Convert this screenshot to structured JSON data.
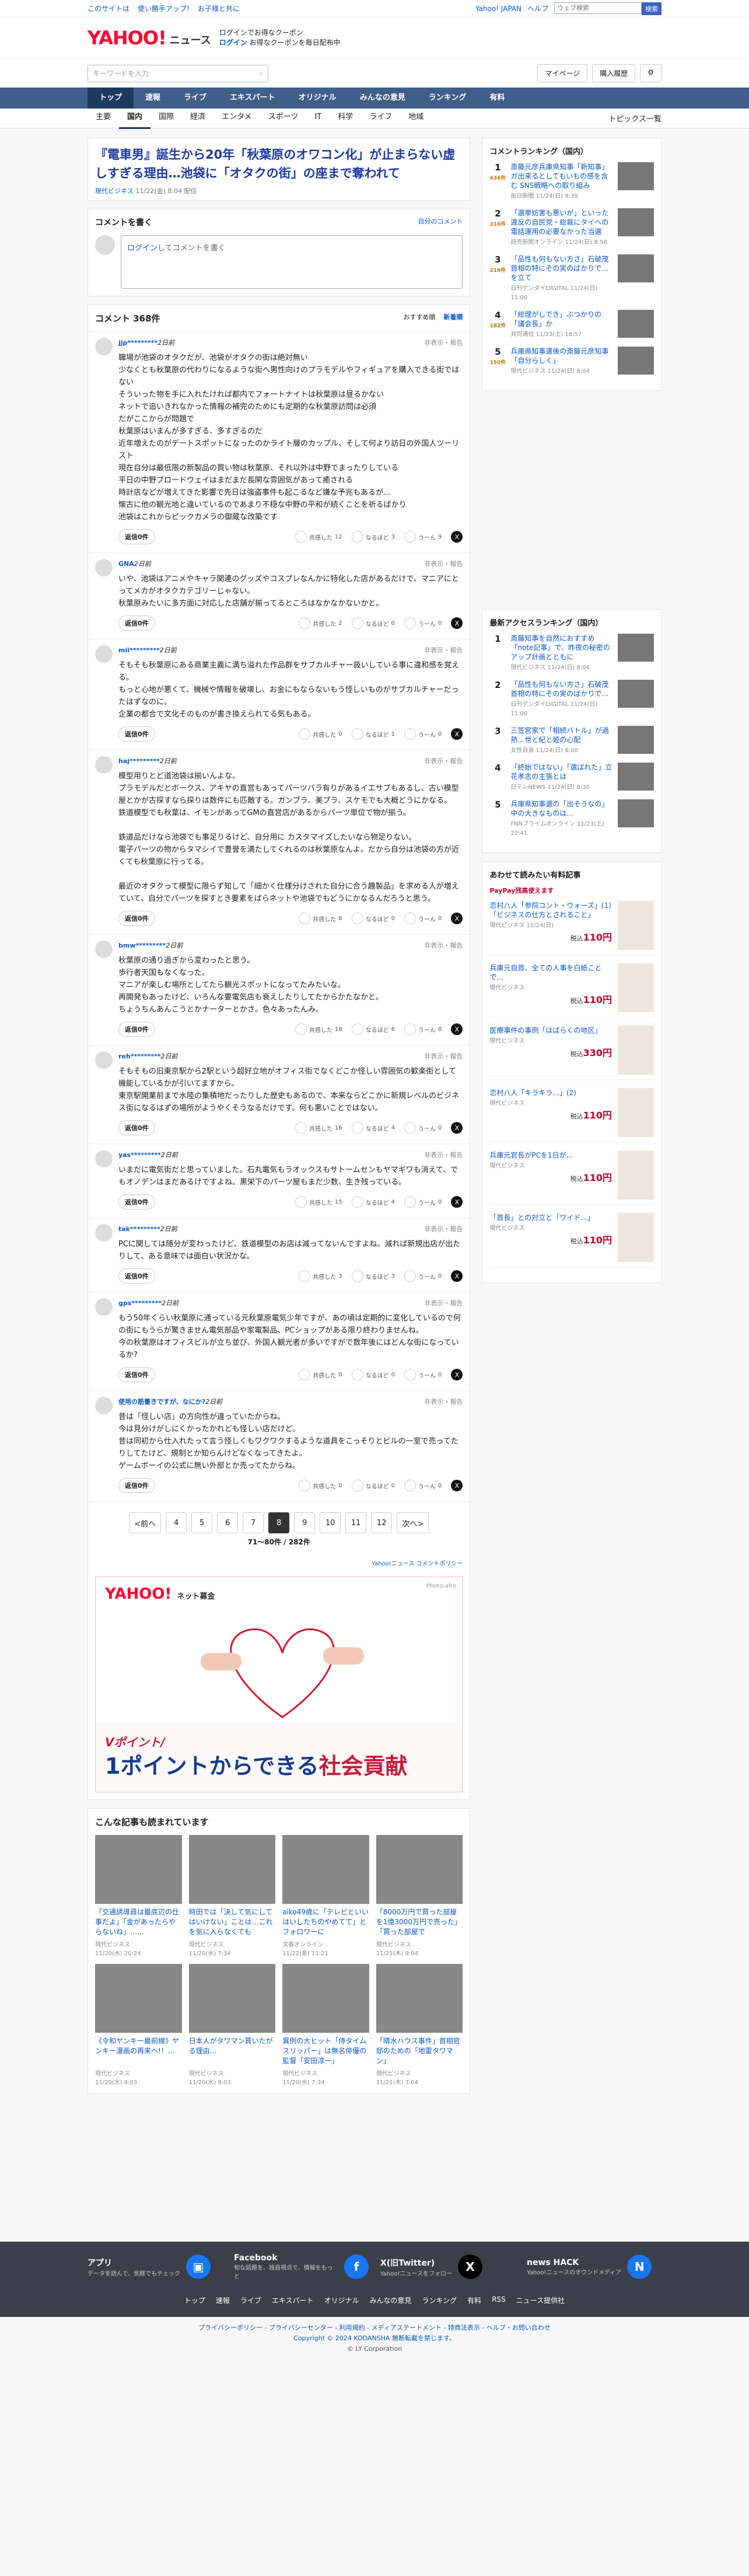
{
  "topbar": {
    "left": [
      "このサイトは",
      "使い勝手アップ!",
      "お子様と共に"
    ],
    "right": [
      "Yahoo! JAPAN",
      "ヘルプ"
    ],
    "search_ph": "ウェブ検索",
    "search_btn": "検索"
  },
  "header": {
    "logo": "YAHOO!",
    "logo_sub": "JAPAN",
    "service": "ニュース",
    "promo_line1": "ログインでお得なクーポン",
    "promo_line2": "ログイン",
    "promo_line3": "お得なクーポンを毎日配布中"
  },
  "search": {
    "placeholder": "キーワードを入力",
    "mypage": "マイページ",
    "buy": "購入履歴"
  },
  "gnav": [
    "トップ",
    "速報",
    "ライブ",
    "エキスパート",
    "オリジナル",
    "みんなの意見",
    "ランキング",
    "有料"
  ],
  "subnav": [
    "主要",
    "国内",
    "国際",
    "経済",
    "エンタメ",
    "スポーツ",
    "IT",
    "科学",
    "ライフ",
    "地域"
  ],
  "subnav_topic": "トピックス一覧",
  "article": {
    "title": "『電車男』誕生から20年「秋葉原のオワコン化」が止まらない虚しすぎる理由…池袋に「オタクの街」の座まで奪われて",
    "source": "現代ビジネス",
    "date": "11/22(金) 8:04 配信"
  },
  "comment_write": {
    "title": "コメントを書く",
    "link": "自分のコメント",
    "login": "ログイン",
    "text": "してコメントを書く"
  },
  "comments": {
    "title": "コメント 368件",
    "sort1": "おすすめ順",
    "sort2": "新着順",
    "reply": "返信0件",
    "support": "共感した",
    "think": "なるほど",
    "ask": "うーん",
    "report": "非表示・報告",
    "items": [
      {
        "user": "jjp*********",
        "time": "2日前",
        "text": "職場が池袋のオタクだが、池袋がオタクの街は絶対無い\n少なくとも秋葉原の代わりになるような街へ男性向けのプラモデルやフィギュアを購入できる街ではない\nそういった物を手に入れたければ都内でフォートナイトは秋葉原は昼るかない\nネットで追いきれなかった情報の補完のためにも定期的な秋葉原訪問は必須\nだがここからが問題で\n秋葉原はいまんが多すぎる、多すぎるのだ\n近年増えたのがデートスポットになったのかライト層のカップル、そして何より訪日の外国人ツーリスト\n現在自分は最低限の新製品の買い物は秋葉原、それ以外は中野でまったりしている\n平日の中野ブロードウェイはまだまだ長閑な雰囲気があって癒される\n時計店などが増えてきた影響で先日は強盗事件も起こるなど嫌な予兆もあるが…\n懐古に他の観光地と違いているのであまり不穏な中野の平和が続くことを祈るばかり\n池袋はこれからピックカメラの御蔵な改築です",
        "a": 12,
        "b": 3,
        "c": 9
      },
      {
        "user": "GNA",
        "time": "2日前",
        "text": "いや、池袋はアニメやキャラ関連のグッズやコスプレなんかに特化した店があるだけで、マニアにとってメカがオタクカテゴリーじゃない。\n秋葉原みたいに多方面に対応した店舗が揃ってるところはなかなかないかと。",
        "a": 2,
        "b": 0,
        "c": 0
      },
      {
        "user": "mii*********",
        "time": "2日前",
        "text": "そもそも秋葉原にある商業主義に満ち溢れた作品群をサブカルチャー扱いしている事に違和感を覚える。\nもっと心地が悪くて、機械や情報を破壊し、お金にもならないもう怪しいものがサブカルチャーだったはずなのに。\n企業の都合で文化そのものが書き換えられてる気もある。",
        "a": 0,
        "b": 1,
        "c": 0
      },
      {
        "user": "haj*********",
        "time": "2日前",
        "text": "模型用りとど道池袋は揃いんよな。\nプラモデルだとボークス、アキヤの直営もあってパーツバラ有りがあるイエサブもあるし、古い模型屋とかが古探すなら探りは数件にも匹敵する。ガンプラ、美プラ、スケモでも大概どうにかなる。\n鉄道模型でも秋葉は、イモンがあってGMの直営店があるからパーツ単位で物が揃う。\n\n鉄道品だけなら池袋でも事足りるけど、自分用に カスタマイズしたいなら物足りない。\n電子パーツの物からタマシイで豊誉を満たしてくれるのは秋葉原なんよ。だから自分は池袋の方が近くても秋葉原に行ってる。\n\n最近のオタクって模型に限らず知して「細かく仕様分けされた自分に合う趣製品」を求める人が増えていて、自分でパーツを探すとき要素をばらネットや池袋でもどうにかなるんだろうと思う。",
        "a": 6,
        "b": 0,
        "c": 0
      },
      {
        "user": "bmw*********",
        "time": "2日前",
        "text": "秋葉原の通り過ぎから変わったと思う。\n歩行者天国もなくなった。\nマニアが楽しむ場所としてたら観光スポットになってたみたいな。\n再開発もあったけど、いろんな要電気店も衰えしたりしてたからかたなかと。\nちょうちんあんこうとかナーターとかさ。色々あったんみ。",
        "a": 18,
        "b": 6,
        "c": 0
      },
      {
        "user": "reh*********",
        "time": "2日前",
        "text": "そもそもの旧東京駅から2駅という超好立地がオフィス街でなくどこか怪しい雰囲気の歓楽街として機能しているかが引いてますから。\n東京駅開業前まで水陸の集積地だったりした歴史もあるので、本来ならどこかに新規レベルのビジネス街になるはずの場所がようやくそうなるだけです。何も悪いことではない。",
        "a": 16,
        "b": 4,
        "c": 0
      },
      {
        "user": "yas*********",
        "time": "2日前",
        "text": "いまだに電気街だと思っていました。石丸電気もラオックスもサトームセンもヤマギワも消えて、でもオノデンはまだあるけですよね。黒栄下のパーツ屋もまだ少数、生き残っている。",
        "a": 15,
        "b": 4,
        "c": 0
      },
      {
        "user": "tak*********",
        "time": "2日前",
        "text": "PCに関しては随分が変わったけど、鉄道模型のお店は減ってないんですよね。減れば新規出店が出たりして、ある意味では面白い状況かな。",
        "a": 3,
        "b": 3,
        "c": 0
      },
      {
        "user": "gps*********",
        "time": "2日前",
        "text": "もう50年くらい秋葉原に通っている元秋葉原電気少年ですが、あの頃は定期的に変化しているので何の街にもうらが驚きません電気部品や家電製品、PCショップがある限り終わりませんね。\n今の秋葉原はオフィスビルが立ち並び、外国人観光者が多いですがで数年後にはどんな街になっているか?",
        "a": 0,
        "b": 0,
        "c": 0
      },
      {
        "user": "使用の筋書きですが、なにか?",
        "time": "2日前",
        "text": "昔は「怪しい店」の方向性が違っていたからね。\n今は見分けがしにくかったかれども怪しい店だけど。\n昔は同初から仕入れたって言う怪しくもワクワクするような道具をこっそりとビルの一室で売ってたりしてたけど、規制とか知らんけどなくなってきたよ。\nゲームボーイの公式に無い外部とか売ってたからね。",
        "a": 0,
        "b": 0,
        "c": 0
      }
    ]
  },
  "pager": {
    "prev": "<前へ",
    "next": "次へ>",
    "pages": [
      "4",
      "5",
      "6",
      "7",
      "8",
      "9",
      "10",
      "11",
      "12"
    ],
    "current": "8",
    "info": "71〜80件 / 282件"
  },
  "policy": "Yahoo!ニュース コメントポリシー",
  "ad": {
    "brand": "YAHOO!",
    "brand_sub": "ネット募金",
    "photo": "Photo:afro",
    "sub": "Vポイント/",
    "main": "1ポイントからできる",
    "main2": "社会貢献"
  },
  "related": {
    "title": "こんな記事も読まれています",
    "items": [
      {
        "t": "「交通誘導員は最底辺の仕事だよ」「金があったらやらないね」……",
        "s": "現代ビジネス",
        "d": "11/20(水) 20:24"
      },
      {
        "t": "時田では「決して気にしてはいけない」ことは…これを気に入らなくても",
        "s": "現代ビジネス",
        "d": "11/20(水) 7:34"
      },
      {
        "t": "aiko49歳に「テレビといいはいしたちのやめてて」とフォロワーに",
        "s": "文春オンライン",
        "d": "11/22(金) 11:21"
      },
      {
        "t": "「8000万円で買った部屋を1億3000万円で売った」「買った部屋で",
        "s": "現代ビジネス",
        "d": "11/21(木) 9:04"
      },
      {
        "t": "《令和ヤンキー最前線》ヤンキー漫画の再来へ!！…",
        "s": "現代ビジネス",
        "d": "11/20(水) 8:03"
      },
      {
        "t": "日本人がタワマン買いたがる理由…",
        "s": "現代ビジネス",
        "d": "11/20(水) 8:03"
      },
      {
        "t": "異例の大ヒット「侍タイムスリッパー」は無名俳優の監督「安田淳一」",
        "s": "現代ビジネス",
        "d": "11/20(水) 7:34"
      },
      {
        "t": "「晴水ハウス事件」首相官邸のための「地雷タワマン」",
        "s": "現代ビジネス",
        "d": "11/21(木) 7:04"
      }
    ]
  },
  "side_ranking": {
    "title": "コメントランキング（国内）",
    "items": [
      {
        "n": "1",
        "c": "436件",
        "t": "斎藤元彦兵庫県知事「新知事」ガ出来るとしてもいもの感を含む SNS戦略への取り組み",
        "m": "毎日新聞 11/24(日) 9:39"
      },
      {
        "n": "2",
        "c": "316件",
        "t": "「選挙妨害も悪いが」といった違反の自民党・総裁にタイへの電話運用の必要なかった当選",
        "m": "読売新聞オンライン 11/24(日) 8:56"
      },
      {
        "n": "3",
        "c": "216件",
        "t": "「品性も何もない方さ」石破茂首相の特にその実のばかりで…を立て",
        "m": "日刊ゲンダイDIGITAL 11/24(日) 11:00"
      },
      {
        "n": "4",
        "c": "182件",
        "t": "「総理がしでき」ぶつかりの「議会長」か",
        "m": "共同通信 11/23(土) 18:57"
      },
      {
        "n": "5",
        "c": "150件",
        "t": "兵庫県知事選後の斎藤元彦知事「自分らしく」",
        "m": "現代ビジネス 11/24(日) 8:04"
      }
    ]
  },
  "side_access": {
    "title": "最新アクセスランキング（国内）",
    "items": [
      {
        "n": "1",
        "t": "斎藤知事を自然におすすめ「note記事」で、昨夜の秘密のアップ計画とともに",
        "m": "現代ビジネス 11/24(日) 8:04"
      },
      {
        "n": "2",
        "t": "「品性も何もない方さ」石破茂首相の特にその実のばかりで…",
        "m": "日刊ゲンダイDIGITAL 11/24(日) 11:00"
      },
      {
        "n": "3",
        "t": "三笠宮家で「相続バトル」が過熱…世と紀と姫の心配",
        "m": "女性自身 11/24(日) 6:00"
      },
      {
        "n": "4",
        "t": "「終始ではない」「選ばれた」立花孝志の主張とは",
        "m": "日テレNEWS 11/24(日) 8:30"
      },
      {
        "n": "5",
        "t": "兵庫県知事選の「出そうなの」中の大きなものは...",
        "m": "FNNプライムオンライン 11/23(土) 22:41"
      }
    ]
  },
  "books": {
    "title": "あわせて読みたい有料記事",
    "paypay": "PayPay残高使えます",
    "price_label": "税込",
    "items": [
      {
        "t": "恋村八人「参院コント・ウォーズ」(1)「ビジネスの仕方とされること」",
        "m": "現代ビジネス 11/24(日)",
        "p": "110円"
      },
      {
        "t": "兵庫元自首、全ての人事を白紙ことで...",
        "m": "現代ビジネス",
        "p": "110円"
      },
      {
        "t": "医療事件の事例「はばらくの地区」",
        "m": "現代ビジネス",
        "p": "330円"
      },
      {
        "t": "恋村八人「キラキラ...」(2)",
        "m": "現代ビジネス",
        "p": "110円"
      },
      {
        "t": "兵庫元官長がPCを1日が...",
        "m": "現代ビジネス",
        "p": "110円"
      },
      {
        "t": "「首長」との対立と「ワイド...」",
        "m": "現代ビジネス",
        "p": "110円"
      }
    ]
  },
  "footer": {
    "apps": [
      {
        "t": "アプリ",
        "d": "データを読んで、気軽でもチェック"
      },
      {
        "t": "Facebook",
        "d": "旬な話題を、独自視点で、情報をもっと"
      },
      {
        "t": "X(旧Twitter)",
        "d": "Yahoo!ニュースをフォロー"
      },
      {
        "t": "news HACK",
        "d": "Yahoo!ニュースのオウンドメディア"
      }
    ],
    "nav": [
      "トップ",
      "速報",
      "ライブ",
      "エキスパート",
      "オリジナル",
      "みんなの意見",
      "ランキング",
      "有料",
      "RSS",
      "ニュース提供社"
    ],
    "links": "プライバシーポリシー - プライバシーセンター - 利用規約 - メディアステートメント - 特商法表示 - ヘルプ・お問い合わせ",
    "copyright": "Copyright © 2024 KODANSHA 無断転載を禁じます。",
    "corp": "© LY Corporation"
  }
}
